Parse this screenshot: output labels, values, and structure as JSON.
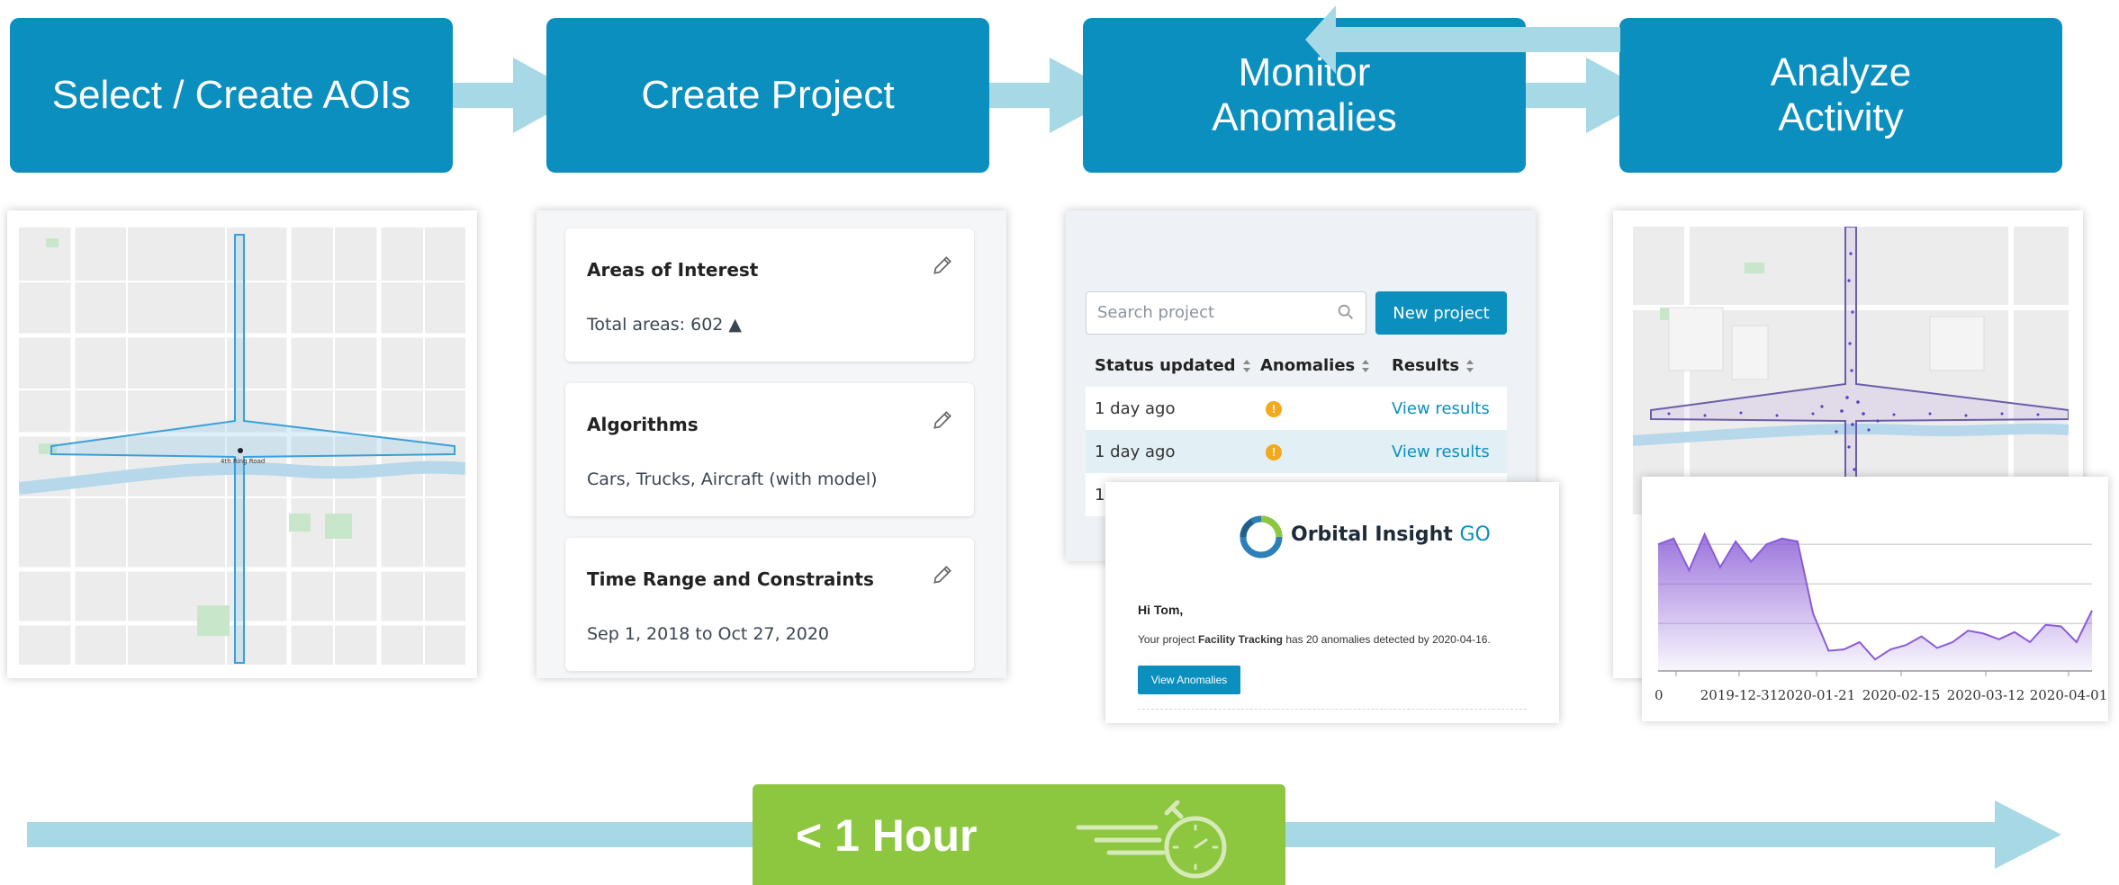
{
  "steps": [
    {
      "label": "Select / Create AOIs"
    },
    {
      "label": "Create Project"
    },
    {
      "label": "Monitor\nAnomalies"
    },
    {
      "label": "Analyze\nActivity"
    }
  ],
  "project_card": {
    "sections": [
      {
        "title": "Areas of Interest",
        "value": "Total areas: 602 ▲"
      },
      {
        "title": "Algorithms",
        "value": "Cars, Trucks, Aircraft (with model)"
      },
      {
        "title": "Time Range and Constraints",
        "value": "Sep 1, 2018 to Oct 27, 2020"
      }
    ]
  },
  "monitor_card": {
    "search_placeholder": "Search project",
    "new_project_label": "New project",
    "headers": [
      "Status updated",
      "Anomalies",
      "Results"
    ],
    "rows": [
      {
        "status": "1 day ago",
        "anomaly": "!",
        "result": "View results"
      },
      {
        "status": "1 day ago",
        "anomaly": "!",
        "result": "View results"
      },
      {
        "status": "1",
        "anomaly": "",
        "result": ""
      }
    ]
  },
  "email": {
    "brand": "Orbital Insight",
    "brand_suffix": "GO",
    "greeting": "Hi Tom,",
    "message_pre": "Your project ",
    "project_name": "Facility Tracking",
    "message_post": " has 20 anomalies detected by 2020-04-16.",
    "button_label": "View Anomalies"
  },
  "map": {
    "road_label": "4th Ring Road"
  },
  "timeline": {
    "label": "< 1 Hour"
  },
  "colors": {
    "step_blue": "#0b8fbe",
    "arrow_light_blue": "#a6d8e6",
    "hour_green": "#8dc63f",
    "chart_purple": "#8a5cd6",
    "anomaly_orange": "#f4a81c"
  },
  "chart_data": {
    "type": "area",
    "x_ticks": [
      "0",
      "2019-12-31",
      "2020-01-21",
      "2020-02-15",
      "2020-03-12",
      "2020-04-01"
    ],
    "values": [
      88,
      92,
      70,
      95,
      72,
      90,
      76,
      88,
      92,
      90,
      40,
      14,
      15,
      20,
      8,
      15,
      18,
      24,
      16,
      20,
      28,
      26,
      22,
      27,
      20,
      32,
      31,
      20,
      42
    ],
    "ylim": [
      0,
      110
    ],
    "grid": true
  }
}
